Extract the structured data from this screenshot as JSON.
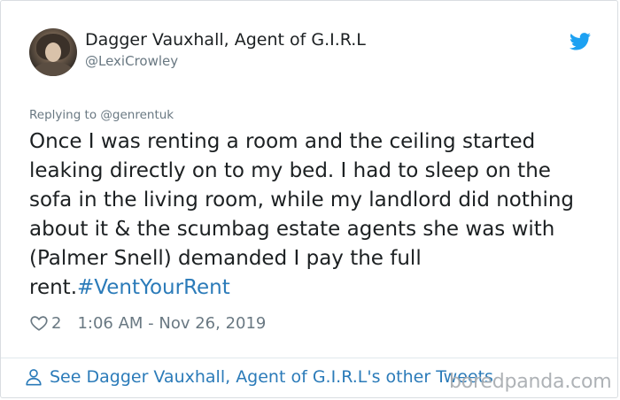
{
  "tweet": {
    "display_name": "Dagger Vauxhall, Agent of G.I.R.L",
    "handle": "@LexiCrowley",
    "replying_to": "Replying to @genrentuk",
    "text_body": "Once I was renting a room and the ceiling started leaking directly on to my bed. I had to sleep on the sofa in the living room, while my landlord did nothing about it & the scumbag estate agents she was with (Palmer Snell) demanded I pay the full rent.",
    "hashtag": "#VentYourRent",
    "likes": "2",
    "timestamp": "1:06 AM - Nov 26, 2019"
  },
  "footer": {
    "link_text": "See Dagger Vauxhall, Agent of G.I.R.L's other Tweets"
  },
  "watermark": "boredpanda.com",
  "icons": {
    "twitter": "twitter-bird-icon",
    "heart": "heart-icon",
    "person": "person-icon"
  },
  "colors": {
    "link_blue": "#2b7bb9",
    "twitter_blue": "#1da1f2",
    "text": "#1c2022",
    "muted": "#697882"
  }
}
